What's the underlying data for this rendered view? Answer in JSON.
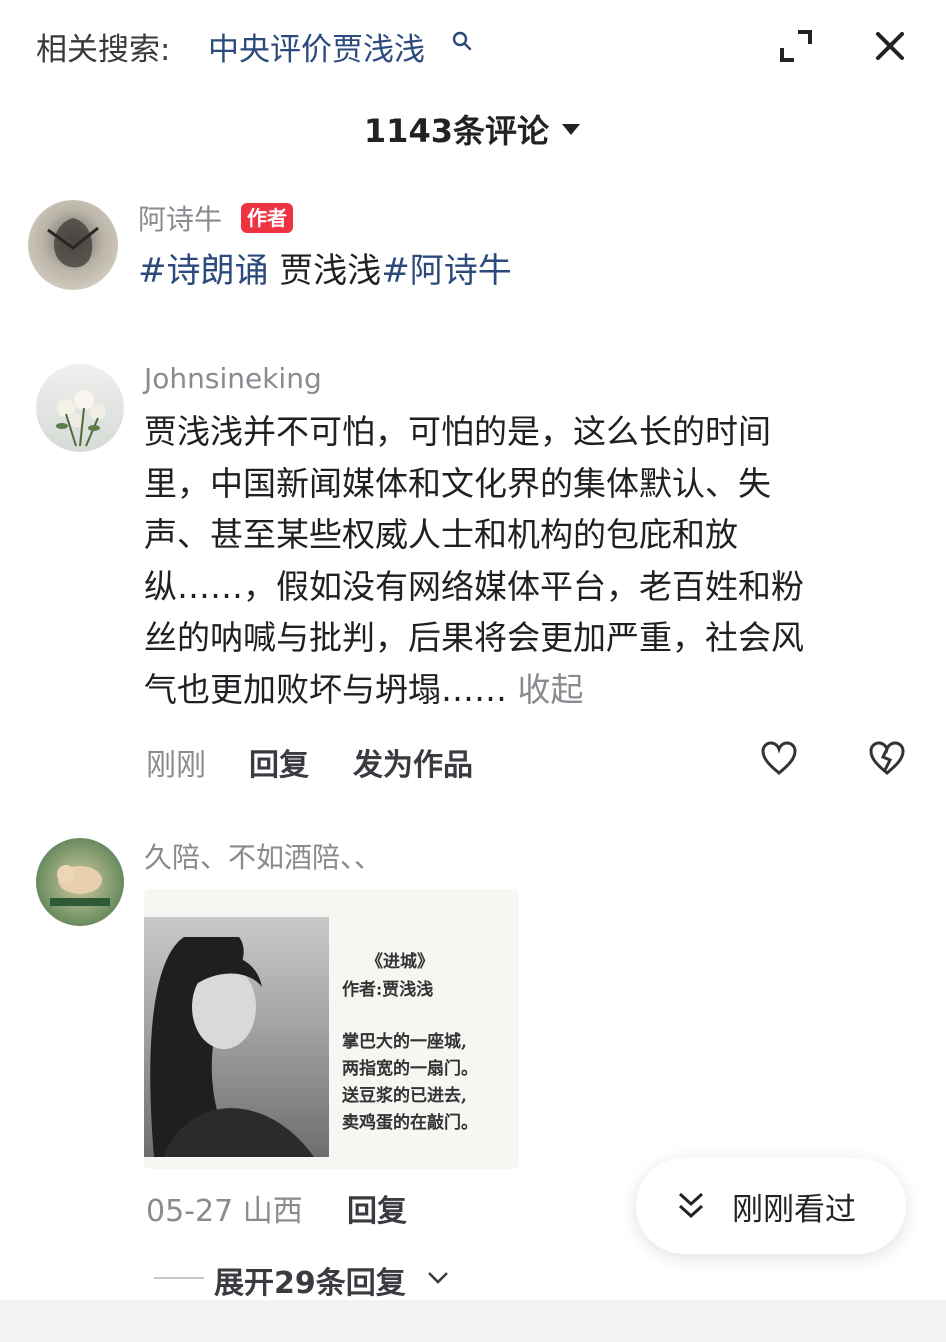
{
  "top_bar": {
    "search_label": "相关搜索:",
    "search_query": "中央评价贾浅浅",
    "expand_icon": "fullscreen-icon",
    "close_icon": "close-icon"
  },
  "comments_header": {
    "count_label": "1143条评论"
  },
  "post": {
    "author": "阿诗牛",
    "badge": "作者",
    "text_tag1": "#诗朗诵",
    "text_middle": " 贾浅浅",
    "text_tag2": "#阿诗牛"
  },
  "comment1": {
    "author": "Johnsineking",
    "lines": [
      "贾浅浅并不可怕，可怕的是，这么长的时间",
      "里，中国新闻媒体和文化界的集体默认、失",
      "声、甚至某些权威人士和机构的包庇和放",
      "纵……，假如没有网络媒体平台，老百姓和粉",
      "丝的呐喊与批判，后果将会更加严重，社会风",
      "气也更加败坏与坍塌……"
    ],
    "collapse_label": " 收起",
    "time": "刚刚",
    "reply_label": "回复",
    "publish_label": "发为作品"
  },
  "comment2": {
    "author": "久陪、不如酒陪、、",
    "poem": {
      "title": "《进城》",
      "byline": "作者:贾浅浅",
      "lines": [
        "掌巴大的一座城,",
        "两指宽的一扇门。",
        "送豆浆的已进去,",
        "卖鸡蛋的在敲门。"
      ]
    },
    "meta": "05-27 山西",
    "reply_label": "回复",
    "expand_replies": "展开29条回复"
  },
  "recently_seen": {
    "label": "刚刚看过"
  }
}
